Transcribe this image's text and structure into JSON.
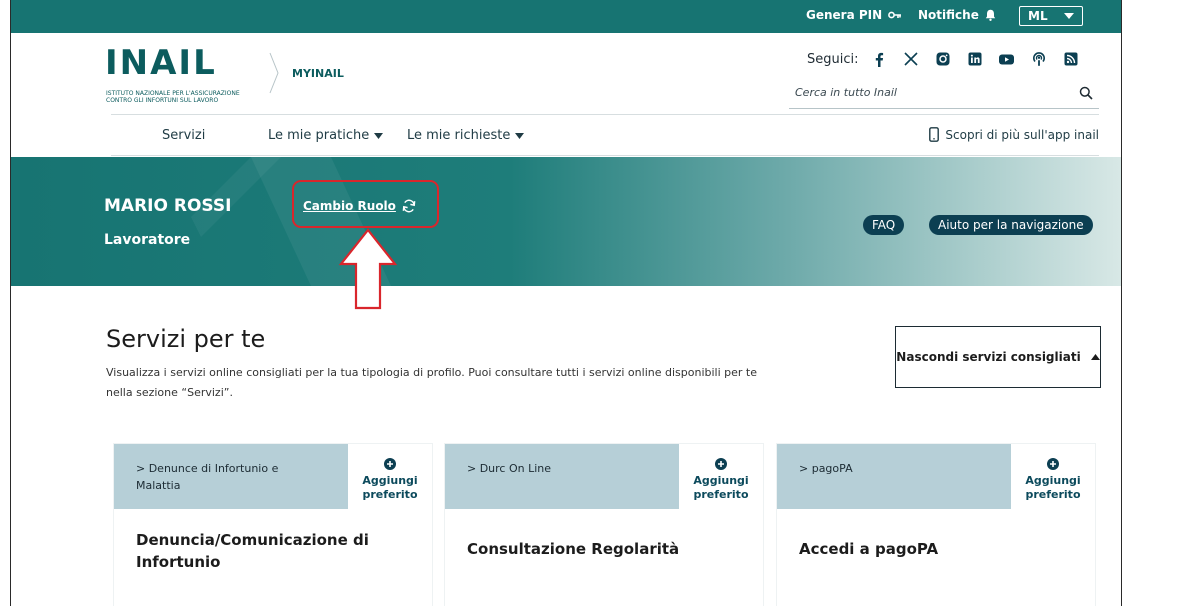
{
  "topbar": {
    "genera_pin": "Genera PIN",
    "notifiche": "Notifiche",
    "user_initials": "ML",
    "color": "#177472"
  },
  "header": {
    "logo_text": "INAIL",
    "logo_sub_1": "ISTITUTO NAZIONALE PER L'ASSICURAZIONE",
    "logo_sub_2": "CONTRO GLI INFORTUNI SUL LAVORO",
    "product": "MYINAIL",
    "seguici_label": "Seguici:",
    "socials": [
      "facebook-icon",
      "x-icon",
      "instagram-icon",
      "linkedin-icon",
      "youtube-icon",
      "podcast-icon",
      "rss-icon"
    ],
    "search_placeholder": "Cerca in tutto Inail"
  },
  "nav": {
    "servizi": "Servizi",
    "mie_pratiche": "Le mie pratiche",
    "mie_richieste": "Le mie richieste",
    "app_link": "Scopri di più sull'app inail"
  },
  "hero": {
    "user_name": "MARIO ROSSI",
    "role": "Lavoratore",
    "cambio_ruolo": "Cambio Ruolo",
    "faq": "FAQ",
    "aiuto": "Aiuto per la navigazione"
  },
  "main": {
    "title": "Servizi per te",
    "description": "Visualizza i servizi online consigliati per la tua tipologia di profilo. Puoi consultare tutti i servizi online disponibili per te nella sezione “Servizi”.",
    "hide_button": "Nascondi servizi consigliati"
  },
  "cards": [
    {
      "category": "> Denunce di Infortunio e Malattia",
      "fav_1": "Aggiungi",
      "fav_2": "preferito",
      "title": "Denuncia/Comunicazione di Infortunio"
    },
    {
      "category": "> Durc On Line",
      "fav_1": "Aggiungi",
      "fav_2": "preferito",
      "title": "Consultazione Regolarità"
    },
    {
      "category": "> pagoPA",
      "fav_1": "Aggiungi",
      "fav_2": "preferito",
      "title": "Accedi a pagoPA"
    }
  ]
}
